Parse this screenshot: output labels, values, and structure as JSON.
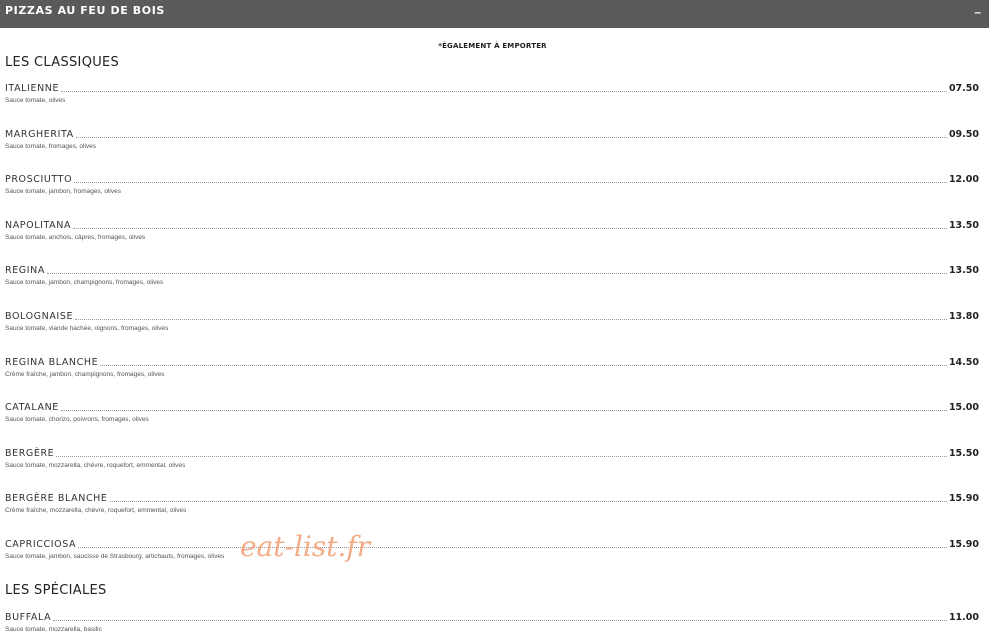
{
  "header": {
    "title": "PIZZAS AU FEU DE BOIS",
    "collapse_symbol": "–"
  },
  "note": "*ÉGALEMENT À EMPORTER",
  "sections": [
    {
      "title": "LES CLASSIQUES",
      "items": [
        {
          "name": "ITALIENNE",
          "price": "07.50",
          "desc": "Sauce tomate, olives"
        },
        {
          "name": "MARGHERITA",
          "price": "09.50",
          "desc": "Sauce tomate, fromages, olives"
        },
        {
          "name": "PROSCIUTTO",
          "price": "12.00",
          "desc": "Sauce tomate, jambon, fromages, olives"
        },
        {
          "name": "NAPOLITANA",
          "price": "13.50",
          "desc": "Sauce tomate, anchois, câpres, fromages, olives"
        },
        {
          "name": "REGINA",
          "price": "13.50",
          "desc": "Sauce tomate, jambon, champignons, fromages, olives"
        },
        {
          "name": "BOLOGNAISE",
          "price": "13.80",
          "desc": "Sauce tomate, viande hachée, oignons, fromages, olives"
        },
        {
          "name": "REGINA BLANCHE",
          "price": "14.50",
          "desc": "Crème fraîche, jambon, champignons, fromages, olives"
        },
        {
          "name": "CATALANE",
          "price": "15.00",
          "desc": "Sauce tomate, chorizo, poivrons, fromages, olives"
        },
        {
          "name": "BERGÈRE",
          "price": "15.50",
          "desc": "Sauce tomate, mozzarella, chèvre, roquefort, emmental, olives"
        },
        {
          "name": "BERGÈRE BLANCHE",
          "price": "15.90",
          "desc": "Crème fraîche, mozzarella, chèvre, roquefort, emmental, olives"
        },
        {
          "name": "CAPRICCIOSA",
          "price": "15.90",
          "desc": "Sauce tomate, jambon, saucisse de Strasbourg, artichauts, fromages, olives"
        }
      ]
    },
    {
      "title": "LES SPÉCIALES",
      "items": [
        {
          "name": "BUFFALA",
          "price": "11.00",
          "desc": "Sauce tomate, mozzarella, basilic"
        }
      ]
    }
  ],
  "watermark": "eat-list.fr",
  "colors": {
    "header_bg": "#5a5a5a",
    "watermark": "#f2a47a"
  }
}
